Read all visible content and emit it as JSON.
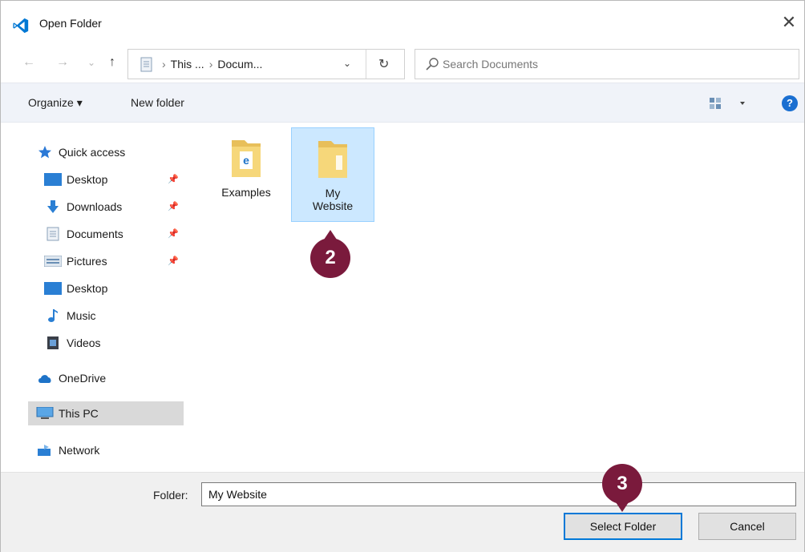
{
  "window": {
    "title": "Open Folder",
    "close_glyph": "✕",
    "app_icon": "vscode-icon"
  },
  "nav": {
    "back_glyph": "←",
    "forward_glyph": "→",
    "recent_glyph": "⌄",
    "up_glyph": "↑",
    "breadcrumb": [
      "This ...",
      "Docum..."
    ],
    "breadcrumb_sep": "›",
    "dropdown_glyph": "⌄",
    "refresh_glyph": "↻",
    "search_placeholder": "Search Documents"
  },
  "toolbar": {
    "organize_label": "Organize ▾",
    "new_folder_label": "New folder",
    "view_icon": "view-options-icon",
    "help_glyph": "?"
  },
  "sidebar": {
    "items": [
      {
        "label": "Quick access",
        "icon": "star-icon",
        "pinned": false
      },
      {
        "label": "Desktop",
        "icon": "desktop-icon",
        "pinned": true
      },
      {
        "label": "Downloads",
        "icon": "download-arrow-icon",
        "pinned": true
      },
      {
        "label": "Documents",
        "icon": "documents-icon",
        "pinned": true
      },
      {
        "label": "Pictures",
        "icon": "pictures-icon",
        "pinned": true
      },
      {
        "label": "Desktop",
        "icon": "desktop-icon",
        "pinned": false
      },
      {
        "label": "Music",
        "icon": "music-note-icon",
        "pinned": false
      },
      {
        "label": "Videos",
        "icon": "videos-icon",
        "pinned": false
      },
      {
        "label": "OneDrive",
        "icon": "cloud-icon",
        "pinned": false
      },
      {
        "label": "This PC",
        "icon": "computer-icon",
        "pinned": false,
        "selected": true
      },
      {
        "label": "Network",
        "icon": "network-icon",
        "pinned": false
      }
    ],
    "pin_glyph": "📌"
  },
  "content": {
    "items": [
      {
        "label": "Examples",
        "icon": "folder-icon",
        "selected": false
      },
      {
        "label_line1": "My",
        "label_line2": "Website",
        "icon": "folder-icon",
        "selected": true
      }
    ]
  },
  "bottom": {
    "folder_label": "Folder:",
    "folder_value": "My Website",
    "select_button": "Select Folder",
    "cancel_button": "Cancel"
  },
  "callouts": {
    "step_2": "2",
    "step_3": "3",
    "color": "#7a1a3c"
  },
  "colors": {
    "selection_bg": "#cce8ff",
    "toolbar_bg": "#f0f3f9",
    "primary_border": "#0078d7",
    "help_blue": "#1a6fd1"
  }
}
